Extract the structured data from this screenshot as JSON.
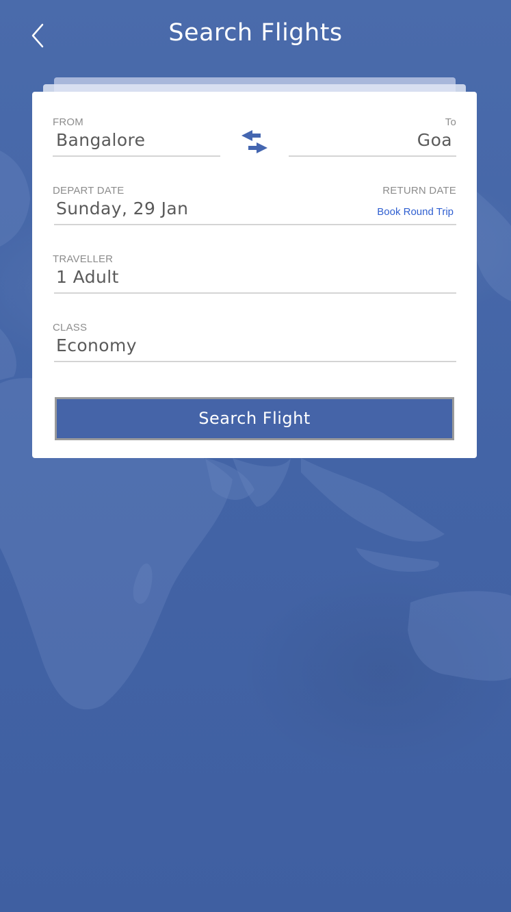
{
  "header": {
    "title": "Search Flights"
  },
  "form": {
    "from_label": "FROM",
    "from_value": "Bangalore",
    "to_label": "To",
    "to_value": "Goa",
    "depart_label": "DEPART DATE",
    "depart_value": "Sunday, 29 Jan",
    "return_label": "RETURN DATE",
    "round_trip_link": "Book Round Trip",
    "traveller_label": "TRAVELLER",
    "traveller_value": "1 Adult",
    "class_label": "CLASS",
    "class_value": "Economy",
    "search_button": "Search Flight"
  },
  "icons": {
    "back": "chevron-left-icon",
    "swap": "swap-arrows-icon"
  },
  "colors": {
    "background": "#4566a8",
    "accent": "#4564a8",
    "link": "#2f5fd0",
    "card": "#ffffff"
  }
}
